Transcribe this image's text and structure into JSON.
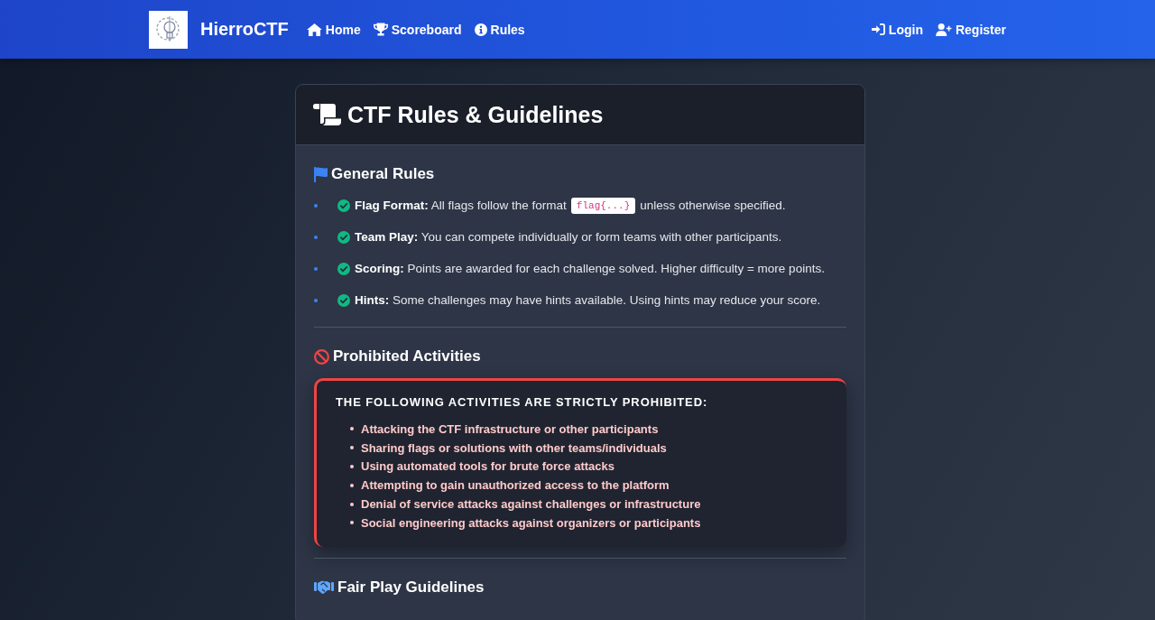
{
  "navbar": {
    "brand": "HierroCTF",
    "links": [
      {
        "label": "Home"
      },
      {
        "label": "Scoreboard"
      },
      {
        "label": "Rules"
      }
    ],
    "auth_links": [
      {
        "label": "Login"
      },
      {
        "label": "Register"
      }
    ]
  },
  "card": {
    "title": "CTF Rules & Guidelines",
    "sections": [
      {
        "kind": "checklist",
        "title": "General Rules",
        "items": [
          {
            "text": "**Flag Format:** All flags follow the format",
            "code": "flag{...}",
            "text_after": "unless otherwise specified."
          },
          {
            "text": "**Team Play:** You can compete individually or form teams with other participants."
          },
          {
            "text": "**Scoring:** Points are awarded for each challenge solved. Higher difficulty = more points."
          },
          {
            "text": "**Hints:** Some challenges may have hints available. Using hints may reduce your score."
          }
        ]
      },
      {
        "kind": "alert",
        "title": "Prohibited Activities",
        "heading": "THE FOLLOWING ACTIVITIES ARE STRICTLY PROHIBITED:",
        "items": [
          "Attacking the CTF infrastructure or other participants",
          "Sharing flags or solutions with other teams/individuals",
          "Using automated tools for brute force attacks",
          "Attempting to gain unauthorized access to the platform",
          "Denial of service attacks against challenges or infrastructure",
          "Social engineering attacks against organizers or participants"
        ]
      },
      {
        "kind": "heading",
        "title": "Fair Play Guidelines"
      }
    ]
  }
}
